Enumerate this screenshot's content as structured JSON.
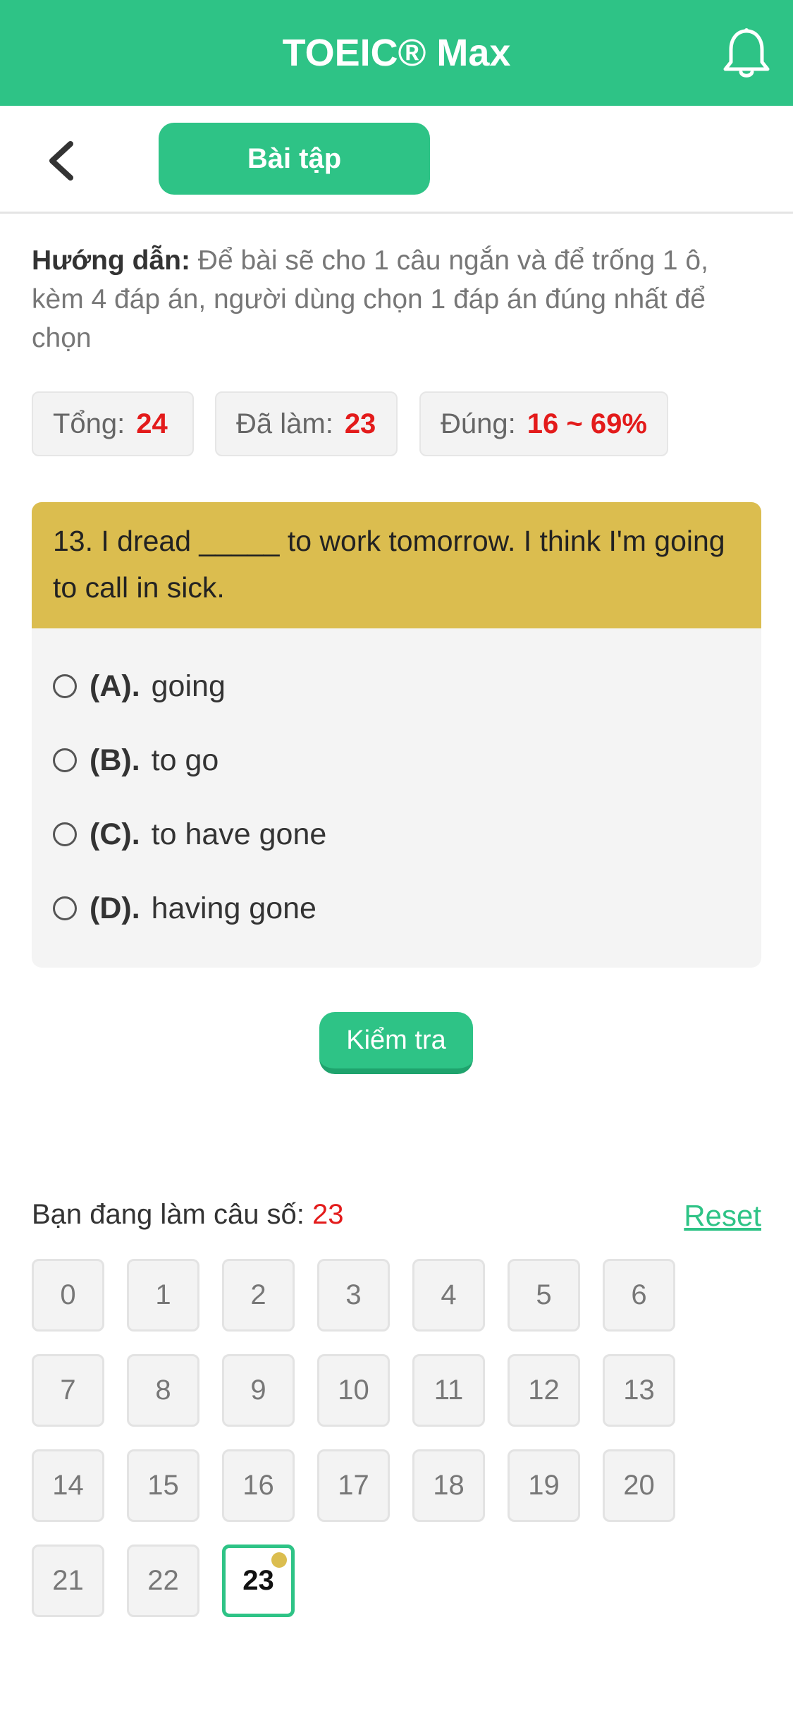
{
  "header": {
    "title": "TOEIC® Max"
  },
  "subnav": {
    "tab_label": "Bài tập"
  },
  "instructions": {
    "label": "Hướng dẫn:",
    "text": " Để bài sẽ cho 1 câu ngắn và để trống 1 ô, kèm 4 đáp án, người dùng chọn 1 đáp án đúng nhất để chọn"
  },
  "stats": [
    {
      "label": "Tổng:",
      "value": "24"
    },
    {
      "label": "Đã làm:",
      "value": "23"
    },
    {
      "label": "Đúng:",
      "value": "16 ~ 69%"
    }
  ],
  "question": {
    "text": "13. I dread _____ to work tomorrow. I think I'm going to call in sick.",
    "options": [
      {
        "key": "(A).",
        "text": "going"
      },
      {
        "key": "(B).",
        "text": "to go"
      },
      {
        "key": "(C).",
        "text": "to have gone"
      },
      {
        "key": "(D).",
        "text": "having gone"
      }
    ]
  },
  "check_button": "Kiểm tra",
  "progress": {
    "label": "Bạn đang làm câu số:",
    "current": "23",
    "reset_label": "Reset"
  },
  "question_numbers": [
    "0",
    "1",
    "2",
    "3",
    "4",
    "5",
    "6",
    "7",
    "8",
    "9",
    "10",
    "11",
    "12",
    "13",
    "14",
    "15",
    "16",
    "17",
    "18",
    "19",
    "20",
    "21",
    "22",
    "23"
  ],
  "colors": {
    "brand": "#2ec386",
    "question_header": "#dbbd4f",
    "highlight": "#e31b1b"
  }
}
